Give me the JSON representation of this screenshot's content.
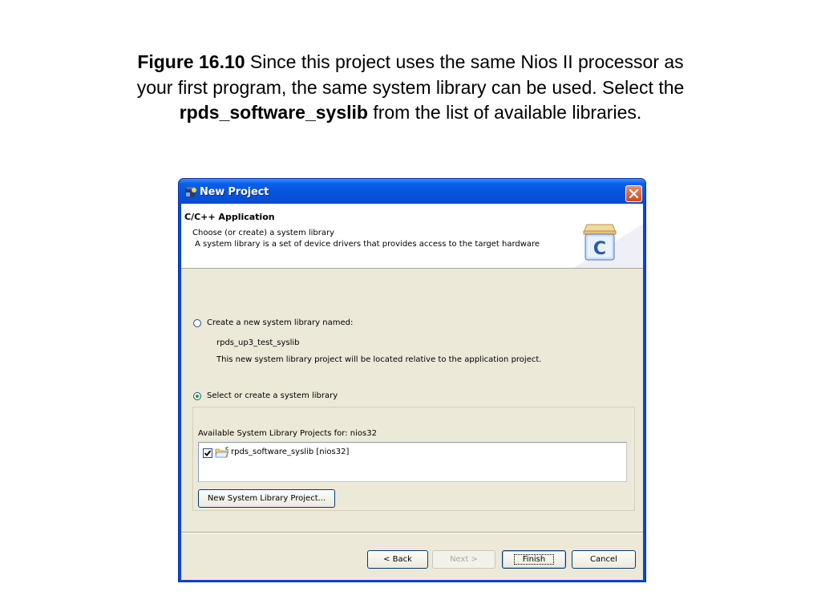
{
  "caption": {
    "label": "Figure 16.10",
    "line1": " Since this project uses the same Nios II processor as",
    "line2": "your first program, the same system library can be used. Select the",
    "bold_term": "rpds_software_syslib",
    "line3_rest": " from the list of available libraries."
  },
  "window": {
    "title": "New Project",
    "app_icon": "eclipse-icon",
    "close_icon": "close-icon"
  },
  "header": {
    "title": "C/C++ Application",
    "description_line1": "Choose (or create) a system library",
    "description_line2": "A system library is a set of device drivers that provides access to the target hardware",
    "icon": "c-project-icon"
  },
  "options": {
    "create_new": {
      "label": "Create a new system library named:",
      "selected": false,
      "library_name": "rpds_up3_test_syslib",
      "note": "This new system library project will be located relative to the application project."
    },
    "select_existing": {
      "label": "Select or create a system library",
      "selected": true
    }
  },
  "library_group": {
    "heading": "Available System Library Projects for:  nios32",
    "items": [
      {
        "label": "rpds_software_syslib [nios32]",
        "checked": true,
        "icon": "c-folder-icon"
      }
    ],
    "new_button_label": "New System Library Project..."
  },
  "buttons": {
    "back": "< Back",
    "next": "Next >",
    "finish": "Finish",
    "cancel": "Cancel"
  },
  "colors": {
    "titlebar": "#0a5fe6",
    "dialog_face": "#ece9d8",
    "radio_dot": "#21a121"
  }
}
